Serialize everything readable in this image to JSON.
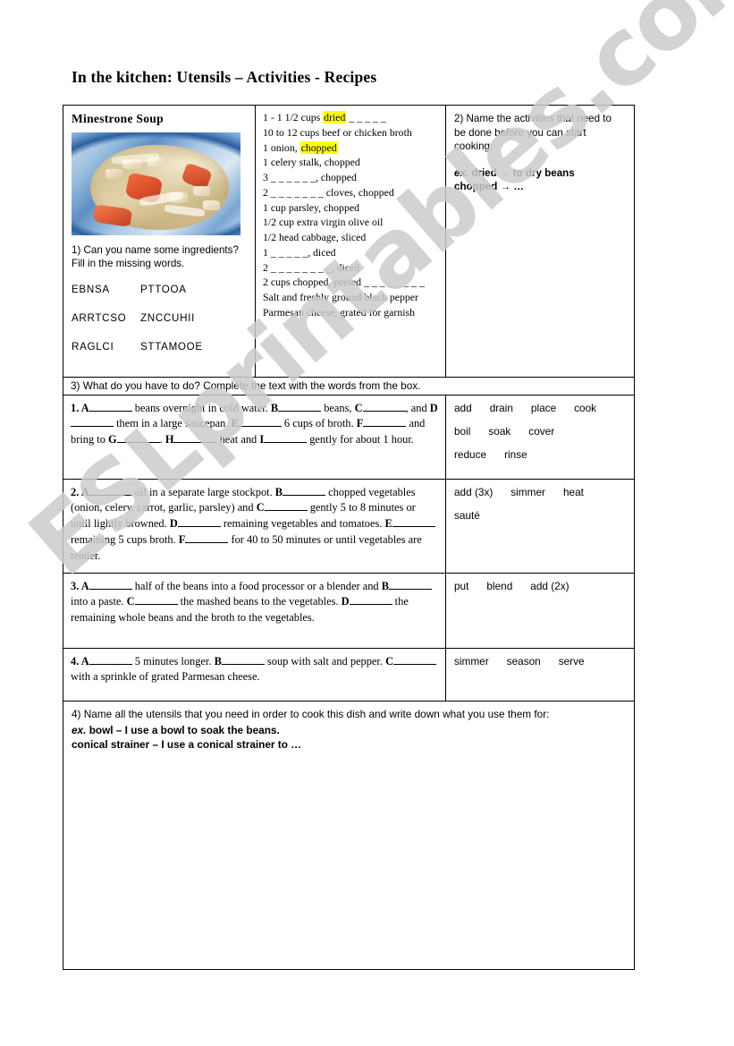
{
  "page": {
    "title": "In the kitchen: Utensils – Activities - Recipes",
    "watermark": "ESLprintables.com",
    "highlight_color": "#ffff00"
  },
  "recipe": {
    "title": "Minestrone Soup",
    "photo_alt": "bowl-of-minestrone-soup",
    "q1_text": "1) Can you name some ingredients? Fill in the missing words.",
    "scrambled_words": [
      {
        "left": "EBNSA",
        "right": "PTTOOA"
      },
      {
        "left": "ARRTCSO",
        "right": "ZNCCUHII"
      },
      {
        "left": "RAGLCI",
        "right": "STTAMOOE"
      }
    ]
  },
  "ingredients": {
    "lines": [
      {
        "pre": "1 - 1 1/2 cups ",
        "hl": "dried",
        "post": " _ _ _ _ _"
      },
      {
        "pre": "10 to 12 cups beef or chicken broth",
        "hl": "",
        "post": ""
      },
      {
        "pre": "1 onion, ",
        "hl": "chopped",
        "post": ""
      },
      {
        "pre": "1 celery stalk, chopped",
        "hl": "",
        "post": ""
      },
      {
        "pre": "3 _ _ _ _ _ _, chopped",
        "hl": "",
        "post": ""
      },
      {
        "pre": "2 _ _ _ _ _ _ _ cloves, chopped",
        "hl": "",
        "post": ""
      },
      {
        "pre": "1 cup parsley, chopped",
        "hl": "",
        "post": ""
      },
      {
        "pre": "1/2 cup extra virgin olive oil",
        "hl": "",
        "post": ""
      },
      {
        "pre": "1/2 head cabbage, sliced",
        "hl": "",
        "post": ""
      },
      {
        "pre": "1 _ _ _ _ _, diced",
        "hl": "",
        "post": ""
      },
      {
        "pre": "2 _ _ _ _ _ _ _ _, diced",
        "hl": "",
        "post": ""
      },
      {
        "pre": "2 cups chopped, peeled _ _ _ _ _ _ _ _",
        "hl": "",
        "post": ""
      },
      {
        "pre": "Salt and freshly ground black pepper",
        "hl": "",
        "post": ""
      },
      {
        "pre": "Parmesan cheese, grated for garnish",
        "hl": "",
        "post": ""
      }
    ]
  },
  "activity2": {
    "prompt": "2) Name the activities that need to be done before you can start cooking:",
    "example_label": "ex.",
    "example_line1": "dried → to dry beans",
    "example_line2": "chopped → …"
  },
  "question3": {
    "heading": "3) What do you have to do?  Complete the text with the words from the box.",
    "steps": [
      {
        "number": "1.",
        "segments": [
          {
            "letter": "A",
            "text": " beans overnight in cold water. "
          },
          {
            "letter": "B",
            "text": " beans, "
          },
          {
            "letter": "C",
            "text": ", and "
          },
          {
            "letter": "D",
            "text": " them in a large saucepan. "
          },
          {
            "letter": "E",
            "text": " 6 cups of broth. "
          },
          {
            "letter": "F",
            "text": " and bring to "
          },
          {
            "letter": "G",
            "text": ". "
          },
          {
            "letter": "H",
            "text": " heat and "
          },
          {
            "letter": "I",
            "text": " gently for about 1 hour."
          }
        ],
        "word_box": [
          [
            "add",
            "drain",
            "place",
            "cook"
          ],
          [
            "boil",
            "soak",
            "cover"
          ],
          [
            "reduce",
            "rinse"
          ]
        ]
      },
      {
        "number": "2.",
        "segments": [
          {
            "letter": "A",
            "text": " oil in a separate large stockpot. "
          },
          {
            "letter": "B",
            "text": " chopped vegetables (onion, celery, carrot, garlic, parsley) and "
          },
          {
            "letter": "C",
            "text": " gently 5 to 8 minutes or until lightly browned. "
          },
          {
            "letter": "D",
            "text": " remaining vegetables and tomatoes. "
          },
          {
            "letter": "E",
            "text": " remaining 5 cups broth. "
          },
          {
            "letter": "F",
            "text": " for 40 to 50 minutes or until vegetables are tender."
          }
        ],
        "word_box": [
          [
            "add (3x)",
            "simmer",
            "heat"
          ],
          [
            "sauté"
          ]
        ]
      },
      {
        "number": "3.",
        "segments": [
          {
            "letter": "A",
            "text": " half of the beans into a food processor or a blender and "
          },
          {
            "letter": "B",
            "text": " into a paste. "
          },
          {
            "letter": "C",
            "text": " the mashed beans to the vegetables. "
          },
          {
            "letter": "D",
            "text": " the remaining whole beans and the broth to the vegetables."
          }
        ],
        "word_box": [
          [
            "put",
            "blend",
            "add (2x)"
          ]
        ]
      },
      {
        "number": "4.",
        "segments": [
          {
            "letter": "A",
            "text": " 5 minutes longer. "
          },
          {
            "letter": "B",
            "text": " soup with salt and pepper. "
          },
          {
            "letter": "C",
            "text": " with a sprinkle of grated Parmesan cheese."
          }
        ],
        "word_box": [
          [
            "simmer",
            "season",
            "serve"
          ]
        ]
      }
    ]
  },
  "question4": {
    "prompt": "4) Name all the utensils that you need in order to cook this dish and write down what you use them for:",
    "example_label": "ex.",
    "example_line1": "bowl – I use a bowl to soak the beans.",
    "example_line2": "conical strainer – I use a conical strainer to …"
  }
}
